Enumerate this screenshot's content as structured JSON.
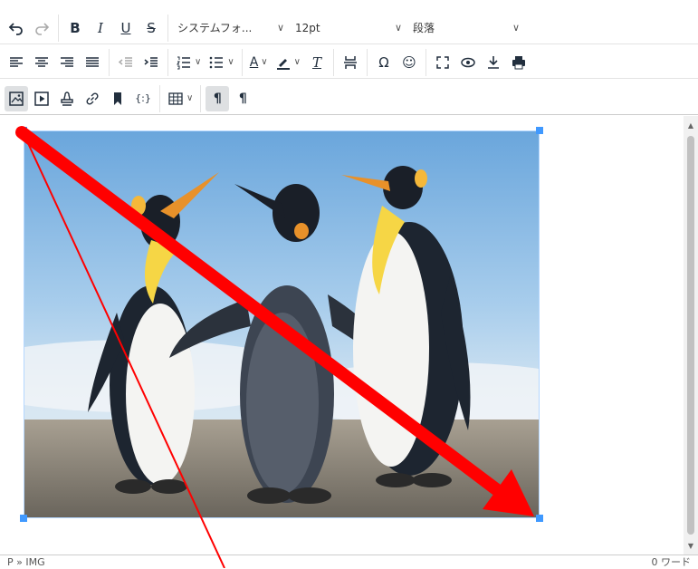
{
  "toolbar": {
    "row1": {
      "undo_icon": "undo-icon",
      "redo_icon": "redo-icon",
      "bold": "B",
      "italic": "I",
      "underline": "U",
      "strikethrough": "S",
      "font_family": "システムフォ...",
      "font_size": "12pt",
      "block_format": "段落"
    },
    "row2": {
      "align_left_icon": "align-left-icon",
      "align_center_icon": "align-center-icon",
      "align_right_icon": "align-right-icon",
      "align_justify_icon": "align-justify-icon",
      "outdent_icon": "outdent-icon",
      "indent_icon": "indent-icon",
      "numbered_list_icon": "numbered-list-icon",
      "bullet_list_icon": "bullet-list-icon",
      "text_color_glyph": "A",
      "highlight_icon": "highlight-icon",
      "clear_format_glyph": "T",
      "page_break_icon": "page-break-icon",
      "special_char": "Ω",
      "emoji": "☺",
      "fullscreen_icon": "fullscreen-icon",
      "preview_icon": "preview-icon",
      "download_icon": "download-icon",
      "print_icon": "print-icon"
    },
    "row3": {
      "image_icon": "image-icon",
      "media_icon": "media-icon",
      "stamp_icon": "stamp-icon",
      "link_icon": "link-icon",
      "bookmark_icon": "bookmark-icon",
      "code_sample": "{:}",
      "table_icon": "table-icon",
      "ltr_glyph": "¶",
      "rtl_glyph": "¶"
    }
  },
  "content": {
    "image_subject": "penguins",
    "colors": {
      "selection_border": "#b4d7ff",
      "handle": "#4099ff",
      "annotation_arrow": "#ff0000"
    }
  },
  "statusbar": {
    "path": "P » IMG",
    "word_count": "0 ワード"
  }
}
